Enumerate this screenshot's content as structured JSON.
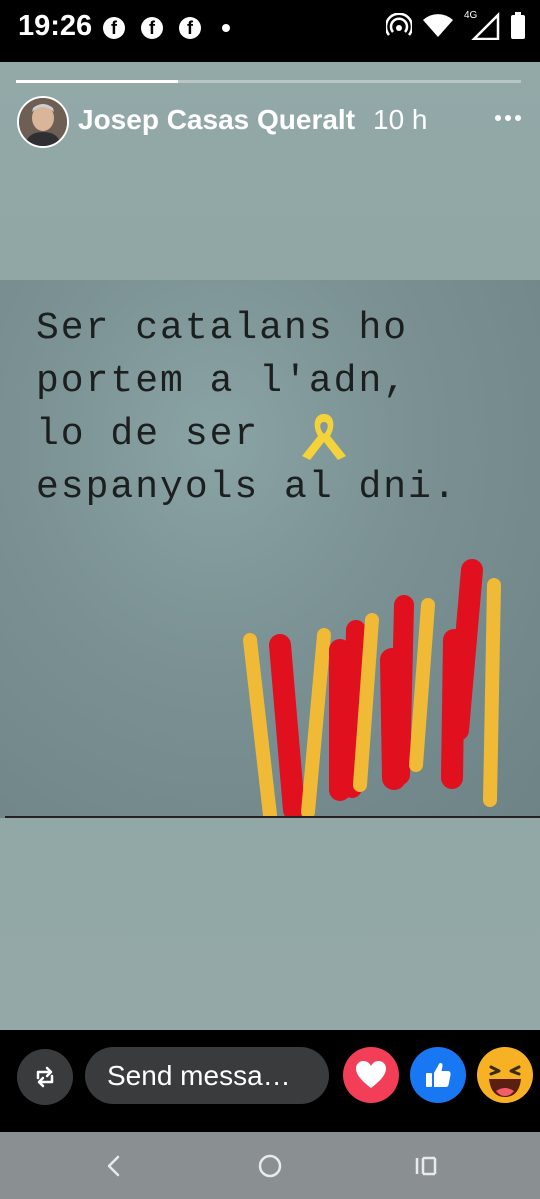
{
  "status_bar": {
    "time": "19:26",
    "icons": [
      "facebook-icon",
      "facebook-icon",
      "facebook-icon",
      "dot-icon",
      "hotspot-icon",
      "wifi-icon",
      "4g-signal-icon",
      "battery-icon"
    ],
    "network_label": "4G"
  },
  "story": {
    "progress": 0.32,
    "author": "Josep Casas Queralt",
    "time_ago": "10 h",
    "image_text": "Ser catalans ho\nportem a l'adn,\nlo de ser\nespanyols al dni.",
    "colors": {
      "flag_red": "#e0101e",
      "flag_yellow": "#f0b936",
      "ribbon": "#f4d23a"
    }
  },
  "footer": {
    "message_placeholder": "Send messa…",
    "reactions": [
      "love-icon",
      "like-icon",
      "haha-icon"
    ],
    "colors": {
      "love": "#f33e58",
      "like": "#1877f2",
      "haha": "#f7b125"
    }
  },
  "nav": {
    "buttons": [
      "back-icon",
      "home-icon",
      "recents-icon"
    ]
  }
}
